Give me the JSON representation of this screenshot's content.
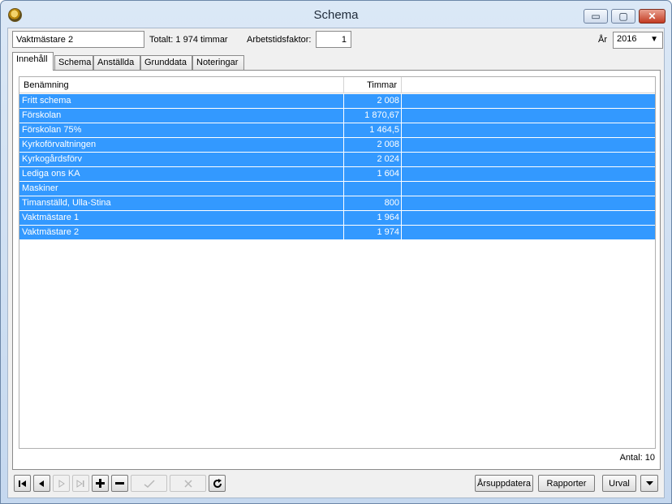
{
  "window": {
    "title": "Schema",
    "controls": {
      "minimize": "▭",
      "maximize": "▢",
      "close": "✕"
    }
  },
  "form": {
    "name_value": "Vaktmästare 2",
    "total_text": "Totalt: 1 974 timmar",
    "factor_label": "Arbetstidsfaktor:",
    "factor_value": "1",
    "year_label": "År",
    "year_value": "2016"
  },
  "tabs": [
    {
      "label": "Innehåll",
      "active": true
    },
    {
      "label": "Schema"
    },
    {
      "label": "Anställda"
    },
    {
      "label": "Grunddata"
    },
    {
      "label": "Noteringar"
    }
  ],
  "table": {
    "columns": [
      "Benämning",
      "Timmar"
    ],
    "rows": [
      {
        "name": "Fritt schema",
        "hours": "2 008"
      },
      {
        "name": "Förskolan",
        "hours": "1 870,67"
      },
      {
        "name": "Förskolan 75%",
        "hours": "1 464,5"
      },
      {
        "name": "Kyrkoförvaltningen",
        "hours": "2 008"
      },
      {
        "name": "Kyrkogårdsförv",
        "hours": "2 024"
      },
      {
        "name": "Lediga ons KA",
        "hours": "1 604"
      },
      {
        "name": "Maskiner",
        "hours": ""
      },
      {
        "name": "Timanställd, Ulla-Stina",
        "hours": "800"
      },
      {
        "name": "Vaktmästare 1",
        "hours": "1 964"
      },
      {
        "name": "Vaktmästare 2",
        "hours": "1 974"
      }
    ],
    "selection_color": "#3399ff"
  },
  "count_text": "Antal: 10",
  "toolbar": {
    "first_icon": "first-record-icon",
    "prev_icon": "previous-record-icon",
    "next_icon": "next-record-icon",
    "last_icon": "last-record-icon",
    "add_icon": "plus-icon",
    "remove_icon": "minus-icon",
    "confirm_icon": "checkmark-icon",
    "cancel_icon": "cross-icon",
    "refresh_icon": "refresh-icon",
    "year_update_label": "Årsuppdatera",
    "reports_label": "Rapporter",
    "selection_label": "Urval"
  }
}
